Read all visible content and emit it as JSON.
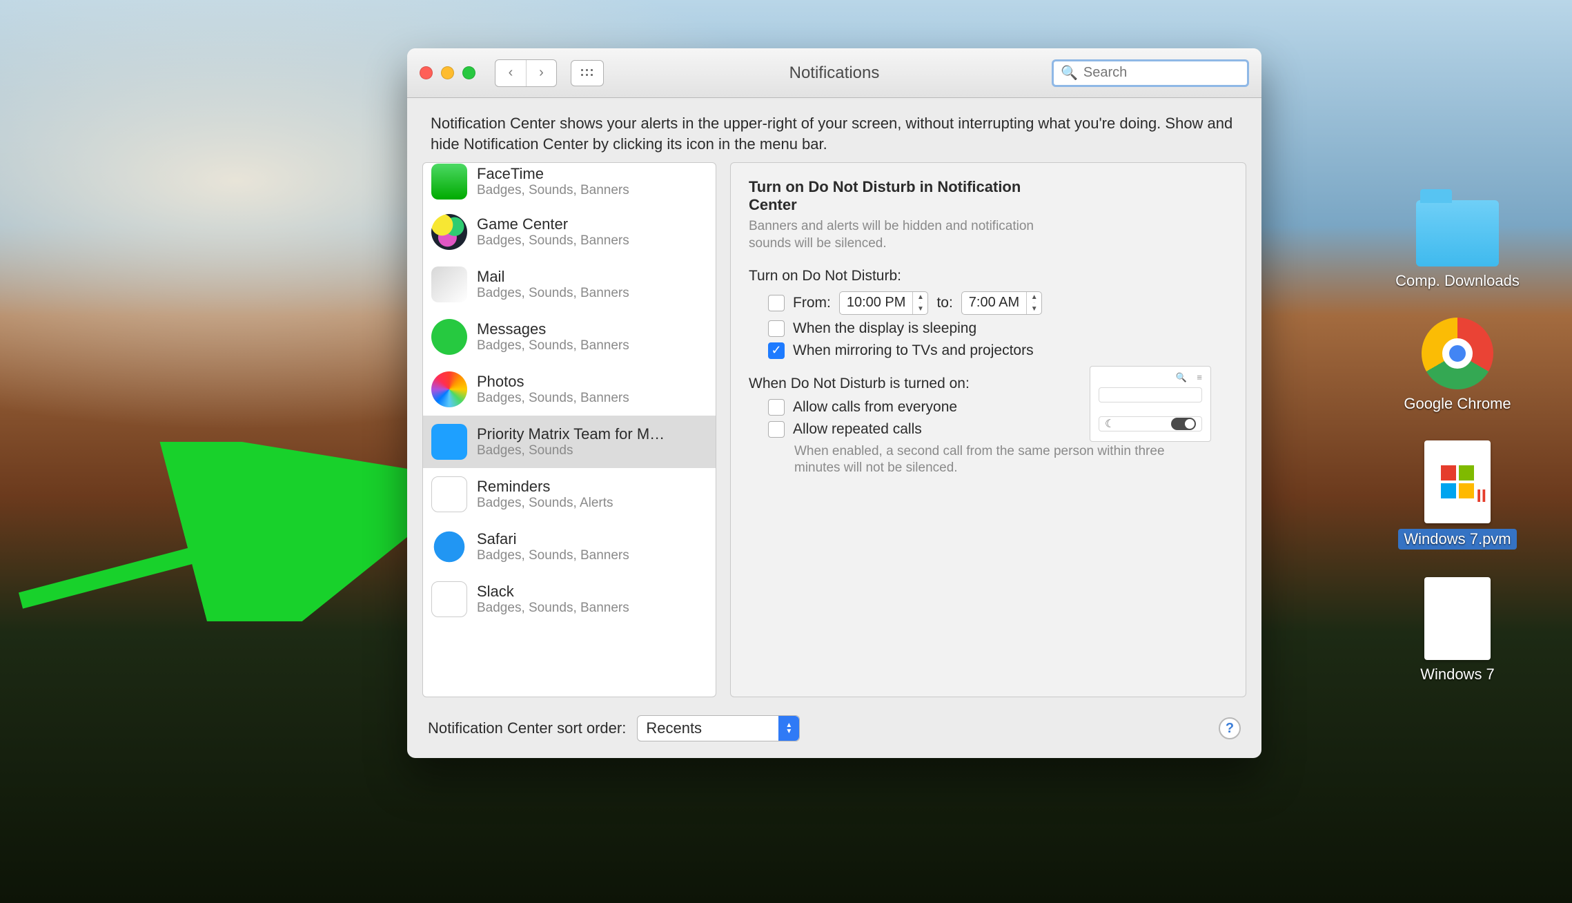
{
  "window": {
    "title": "Notifications",
    "search_placeholder": "Search",
    "description": "Notification Center shows your alerts in the upper-right of your screen, without interrupting what you're doing. Show and hide Notification Center by clicking its icon in the menu bar."
  },
  "apps": [
    {
      "name": "FaceTime",
      "sub": "Badges, Sounds, Banners",
      "icon": "ic-facetime"
    },
    {
      "name": "Game Center",
      "sub": "Badges, Sounds, Banners",
      "icon": "ic-gamecenter"
    },
    {
      "name": "Mail",
      "sub": "Badges, Sounds, Banners",
      "icon": "ic-mail"
    },
    {
      "name": "Messages",
      "sub": "Badges, Sounds, Banners",
      "icon": "ic-messages"
    },
    {
      "name": "Photos",
      "sub": "Badges, Sounds, Banners",
      "icon": "ic-photos"
    },
    {
      "name": "Priority Matrix Team for M…",
      "sub": "Badges, Sounds",
      "icon": "ic-pm",
      "selected": true
    },
    {
      "name": "Reminders",
      "sub": "Badges, Sounds, Alerts",
      "icon": "ic-reminders"
    },
    {
      "name": "Safari",
      "sub": "Badges, Sounds, Banners",
      "icon": "ic-safari"
    },
    {
      "name": "Slack",
      "sub": "Badges, Sounds, Banners",
      "icon": "ic-slack"
    }
  ],
  "detail": {
    "heading": "Turn on Do Not Disturb in Notification Center",
    "blurb": "Banners and alerts will be hidden and notification sounds will be silenced.",
    "schedule_label": "Turn on Do Not Disturb:",
    "from_label": "From:",
    "from_time": "10:00 PM",
    "to_label": "to:",
    "to_time": "7:00 AM",
    "opt_display": "When the display is sleeping",
    "opt_mirror": "When mirroring to TVs and projectors",
    "when_on_label": "When Do Not Disturb is turned on:",
    "opt_everyone": "Allow calls from everyone",
    "opt_repeated": "Allow repeated calls",
    "repeated_hint": "When enabled, a second call from the same person within three minutes will not be silenced."
  },
  "footer": {
    "sort_label": "Notification Center sort order:",
    "sort_value": "Recents"
  },
  "desktop_icons": {
    "folder": "Comp. Downloads",
    "chrome": "Google Chrome",
    "win_pvm": "Windows 7.pvm",
    "win7": "Windows 7"
  }
}
